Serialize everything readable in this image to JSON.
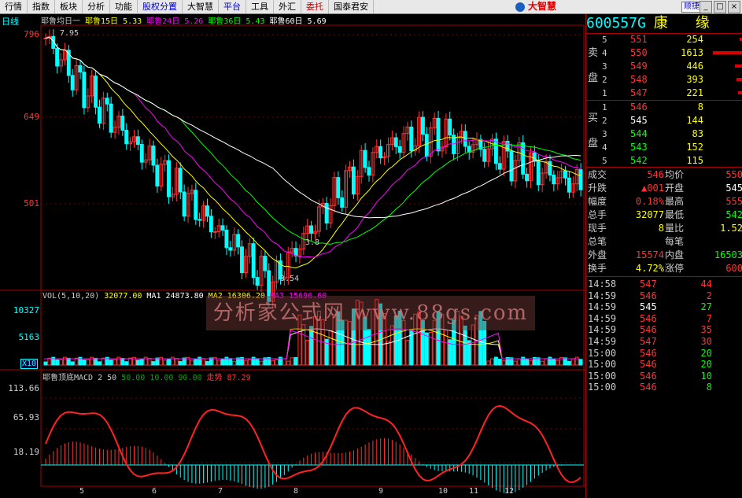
{
  "menu": [
    {
      "label": "行情",
      "color": ""
    },
    {
      "label": "指数",
      "color": ""
    },
    {
      "label": "板块",
      "color": ""
    },
    {
      "label": "分析",
      "color": ""
    },
    {
      "label": "功能",
      "color": ""
    },
    {
      "label": "股权分置",
      "color": "blue"
    },
    {
      "label": "大智慧",
      "color": ""
    },
    {
      "label": "平台",
      "color": "blue"
    },
    {
      "label": "工具",
      "color": ""
    },
    {
      "label": "外汇",
      "color": ""
    },
    {
      "label": "委托",
      "color": "red"
    },
    {
      "label": "国泰君安",
      "color": ""
    }
  ],
  "brand": "大智慧",
  "switch_button": "顺捷",
  "window_buttons": [
    "_",
    "□",
    "×"
  ],
  "chart": {
    "period_label": "日线",
    "ma_legend": [
      {
        "text": "耶鲁均日一",
        "color": "#cccccc"
      },
      {
        "text": "耶鲁15日 5.33",
        "color": "#ffff00"
      },
      {
        "text": "耶鲁24日 5.26",
        "color": "#ff00ff"
      },
      {
        "text": "耶鲁36日 5.43",
        "color": "#00ff00"
      },
      {
        "text": "耶鲁60日 5.69",
        "color": "#ffffff"
      }
    ],
    "price_axis": [
      "796",
      "649",
      "501"
    ],
    "annotations": {
      "high_label": "7.95",
      "low_label": "3.54",
      "mid_label": "3.8"
    },
    "vol_legend": [
      {
        "text": "VOL(5,10,20)",
        "color": "#cccccc"
      },
      {
        "text": "32077.00",
        "color": "#ffff00"
      },
      {
        "text": "MA1 24873.80",
        "color": "#ffffff"
      },
      {
        "text": "MA2 16306.20",
        "color": "#ffff00"
      },
      {
        "text": "MA3 15696.60",
        "color": "#ff00ff"
      }
    ],
    "vol_axis": [
      "10327",
      "5163",
      "X10"
    ],
    "macd_legend": [
      {
        "text": "耶鲁顶底MACD 2 50",
        "color": "#cccccc"
      },
      {
        "text": "50.00",
        "color": "#00aa00"
      },
      {
        "text": "10.00",
        "color": "#00aa00"
      },
      {
        "text": "90.00",
        "color": "#00aa00"
      },
      {
        "text": "走势 87.29",
        "color": "#ff3333"
      }
    ],
    "macd_axis": [
      "113.66",
      "65.93",
      "18.19"
    ],
    "x_labels": [
      "5",
      "6",
      "7",
      "8",
      "9",
      "10",
      "11",
      "12"
    ],
    "watermark": "分析家公式网 www.88gs.com"
  },
  "quote": {
    "code": "600557G",
    "name": "康 缘",
    "sell_side": "卖盘",
    "buy_side": "买盘",
    "asks": [
      {
        "level": "5",
        "price": "551",
        "vol": "254"
      },
      {
        "level": "4",
        "price": "550",
        "vol": "1613"
      },
      {
        "level": "3",
        "price": "549",
        "vol": "446"
      },
      {
        "level": "2",
        "price": "548",
        "vol": "393"
      },
      {
        "level": "1",
        "price": "547",
        "vol": "221"
      }
    ],
    "bids": [
      {
        "level": "1",
        "price": "546",
        "vol": "8"
      },
      {
        "level": "2",
        "price": "545",
        "vol": "144"
      },
      {
        "level": "3",
        "price": "544",
        "vol": "83"
      },
      {
        "level": "4",
        "price": "543",
        "vol": "152"
      },
      {
        "level": "5",
        "price": "542",
        "vol": "115"
      }
    ],
    "stats": [
      {
        "k1": "成交",
        "v1": "546",
        "c1": "#ff3333",
        "k2": "均价",
        "v2": "550",
        "c2": "#ff3333"
      },
      {
        "k1": "升跌",
        "v1": "▲001",
        "c1": "#ff3333",
        "k2": "开盘",
        "v2": "545",
        "c2": "#ffffff"
      },
      {
        "k1": "幅度",
        "v1": "0.18%",
        "c1": "#ff3333",
        "k2": "最高",
        "v2": "555",
        "c2": "#ff3333"
      },
      {
        "k1": "总手",
        "v1": "32077",
        "c1": "#ffff00",
        "k2": "最低",
        "v2": "542",
        "c2": "#00ff00"
      },
      {
        "k1": "现手",
        "v1": "8",
        "c1": "#ffff00",
        "k2": "量比",
        "v2": "1.52",
        "c2": "#ffff00"
      },
      {
        "k1": "总笔",
        "v1": "",
        "c1": "#ffff00",
        "k2": "每笔",
        "v2": "",
        "c2": "#ffff00"
      },
      {
        "k1": "外盘",
        "v1": "15574",
        "c1": "#ff3333",
        "k2": "内盘",
        "v2": "16503",
        "c2": "#00ff00"
      },
      {
        "k1": "换手",
        "v1": "4.72%",
        "c1": "#ffff00",
        "k2": "涨停",
        "v2": "600",
        "c2": "#ff3333"
      }
    ],
    "ticks": [
      {
        "time": "14:58",
        "price": "547",
        "vol": "44",
        "pc": "#ff3333",
        "vc": "#ff3333"
      },
      {
        "time": "14:59",
        "price": "546",
        "vol": "2",
        "pc": "#ff3333",
        "vc": "#ff3333"
      },
      {
        "time": "14:59",
        "price": "545",
        "vol": "27",
        "pc": "#ffffff",
        "vc": "#00ff00"
      },
      {
        "time": "14:59",
        "price": "546",
        "vol": "7",
        "pc": "#ff3333",
        "vc": "#ff3333"
      },
      {
        "time": "14:59",
        "price": "546",
        "vol": "35",
        "pc": "#ff3333",
        "vc": "#ff3333"
      },
      {
        "time": "14:59",
        "price": "547",
        "vol": "30",
        "pc": "#ff3333",
        "vc": "#ff3333"
      },
      {
        "time": "15:00",
        "price": "546",
        "vol": "20",
        "pc": "#ff3333",
        "vc": "#00ff00"
      },
      {
        "time": "15:00",
        "price": "546",
        "vol": "20",
        "pc": "#ff3333",
        "vc": "#00ff00"
      },
      {
        "time": "15:00",
        "price": "546",
        "vol": "10",
        "pc": "#ff3333",
        "vc": "#00ff00"
      },
      {
        "time": "15:00",
        "price": "546",
        "vol": "8",
        "pc": "#ff3333",
        "vc": "#00ff00"
      }
    ]
  }
}
